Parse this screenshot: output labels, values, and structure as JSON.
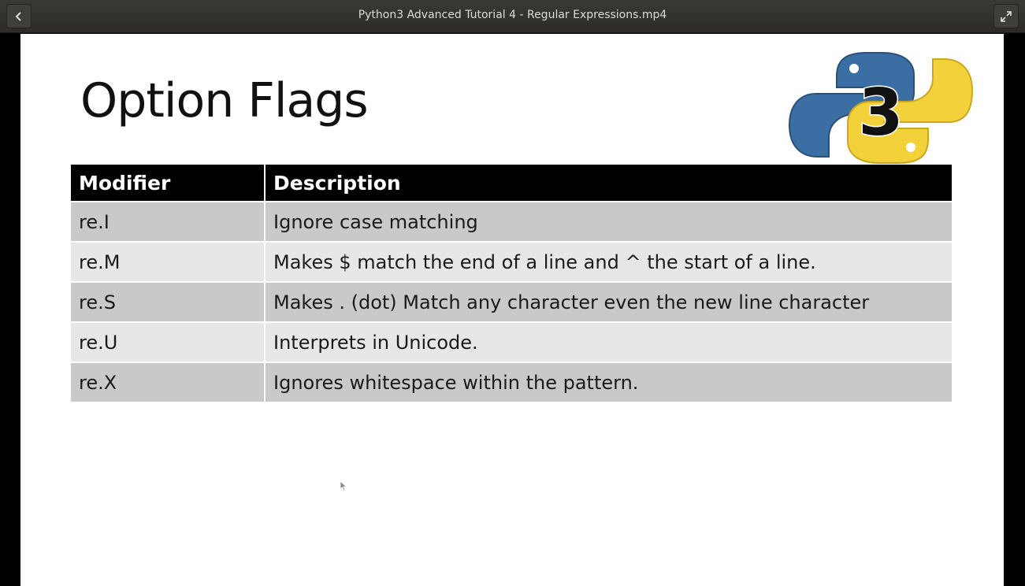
{
  "window": {
    "title": "Python3 Advanced Tutorial 4 - Regular Expressions.mp4",
    "back_icon": "chevron-left-icon",
    "fullscreen_icon": "expand-arrows-icon"
  },
  "slide": {
    "title": "Option Flags",
    "logo": {
      "icon": "python3-logo",
      "text": "3",
      "colors": {
        "blue": "#3b6fa4",
        "yellow": "#f2d13b"
      }
    },
    "table": {
      "headers": [
        "Modifier",
        "Description"
      ],
      "rows": [
        {
          "modifier": "re.I",
          "description": "Ignore case matching"
        },
        {
          "modifier": "re.M",
          "description": "Makes $ match the end of a line and ^ the start of a line."
        },
        {
          "modifier": "re.S",
          "description": "Makes . (dot) Match any character even the new line character"
        },
        {
          "modifier": "re.U",
          "description": "Interprets in Unicode."
        },
        {
          "modifier": "re.X",
          "description": "Ignores whitespace within the pattern."
        }
      ]
    }
  }
}
